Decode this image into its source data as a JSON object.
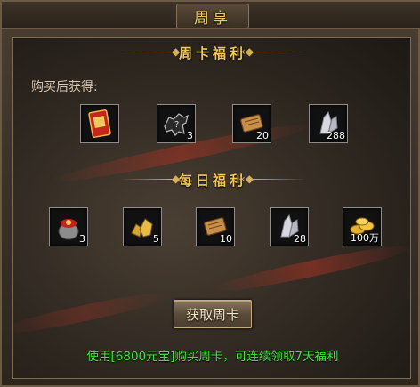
{
  "window": {
    "title": "周享"
  },
  "weekly_section": {
    "title": "周卡福利",
    "subtitle": "购买后获得:",
    "items": [
      {
        "icon": "red-card-icon",
        "count": ""
      },
      {
        "icon": "horse-silhouette-icon",
        "count": "3"
      },
      {
        "icon": "scroll-icon",
        "count": "20"
      },
      {
        "icon": "crystal-icon",
        "count": "288"
      }
    ]
  },
  "daily_section": {
    "title": "每日福利",
    "items": [
      {
        "icon": "treasure-pot-icon",
        "count": "3"
      },
      {
        "icon": "gold-ore-icon",
        "count": "5"
      },
      {
        "icon": "scroll-icon",
        "count": "10"
      },
      {
        "icon": "crystal-icon",
        "count": "28"
      },
      {
        "icon": "gold-coins-icon",
        "count": "100万"
      }
    ]
  },
  "claim_button": {
    "label": "获取周卡"
  },
  "footer": {
    "note": "使用[6800元宝]购买周卡，可连续领取7天福利"
  },
  "colors": {
    "title_gold": "#f1c95a",
    "footer_green": "#3fe23f",
    "slot_border": "#8d8d8d"
  }
}
